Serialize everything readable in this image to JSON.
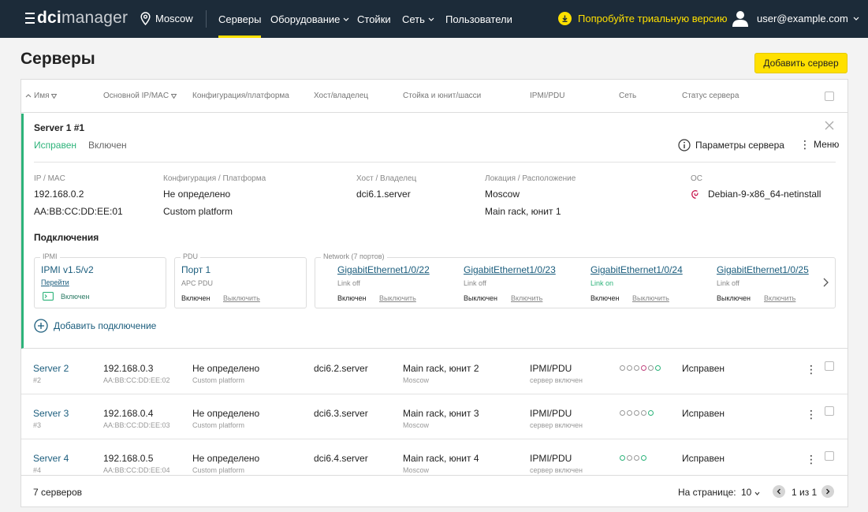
{
  "nav": {
    "logo_bold": "dci",
    "logo_light": "manager",
    "location": "Moscow",
    "items": [
      {
        "label": "Серверы",
        "active": true
      },
      {
        "label": "Оборудование",
        "caret": true
      },
      {
        "label": "Стойки"
      },
      {
        "label": "Сеть",
        "caret": true
      },
      {
        "label": "Пользователи"
      }
    ],
    "trial": "Попробуйте триальную версию",
    "user": "user@example.com"
  },
  "page": {
    "title": "Серверы",
    "add_button": "Добавить сервер"
  },
  "table": {
    "headers": {
      "name": "Имя",
      "ip": "Основной IP/MAC",
      "config": "Конфигурация/платформа",
      "host": "Хост/владелец",
      "rack": "Стойка и юнит/шасси",
      "ipmi": "IPMI/PDU",
      "net": "Сеть",
      "status": "Статус сервера"
    }
  },
  "expanded": {
    "title": "Server 1 #1",
    "status": "Исправен",
    "power": "Включен",
    "params": "Параметры сервера",
    "menu": "Меню",
    "fields": {
      "ipmac_label": "IP / MAC",
      "ip": "192.168.0.2",
      "mac": "AA:BB:CC:DD:EE:01",
      "config_label": "Конфигурация / Платформа",
      "config": "Не определено",
      "platform": "Custom platform",
      "host_label": "Хост / Владелец",
      "host": "dci6.1.server",
      "loc_label": "Локация / Расположение",
      "location": "Moscow",
      "rack": "Main rack, юнит 1",
      "os_label": "ОС",
      "os": "Debian-9-x86_64-netinstall"
    },
    "connections_title": "Подключения",
    "ipmi": {
      "legend": "IPMI",
      "name": "IPMI v1.5/v2",
      "goto": "Перейти",
      "state": "Включен"
    },
    "pdu": {
      "legend": "PDU",
      "port": "Порт 1",
      "model": "APC PDU",
      "state": "Включен",
      "action": "Выключить"
    },
    "network": {
      "legend": "Network (7 портов)",
      "ports": [
        {
          "name": "GigabitEthernet1/0/22",
          "link": "Link off",
          "state": "Включен",
          "action": "Выключить",
          "link_on": false
        },
        {
          "name": "GigabitEthernet1/0/23",
          "link": "Link off",
          "state": "Выключен",
          "action": "Включить",
          "link_on": false
        },
        {
          "name": "GigabitEthernet1/0/24",
          "link": "Link on",
          "state": "Включен",
          "action": "Выключить",
          "link_on": true
        },
        {
          "name": "GigabitEthernet1/0/25",
          "link": "Link off",
          "state": "Выключен",
          "action": "Включить",
          "link_on": false
        }
      ]
    },
    "add_connection": "Добавить подключение"
  },
  "rows": [
    {
      "name": "Server 2",
      "num": "#2",
      "ip": "192.168.0.3",
      "mac": "AA:BB:CC:DD:EE:02",
      "config": "Не определено",
      "platform": "Custom platform",
      "host": "dci6.2.server",
      "rack": "Main rack, юнит 2",
      "location": "Moscow",
      "ipmi": "IPMI/PDU",
      "ipmi_state": "сервер включен",
      "status": "Исправен",
      "dots": [
        "#999",
        "#999",
        "#999",
        "#c0457e",
        "#999",
        "#2db37a"
      ]
    },
    {
      "name": "Server 3",
      "num": "#3",
      "ip": "192.168.0.4",
      "mac": "AA:BB:CC:DD:EE:03",
      "config": "Не определено",
      "platform": "Custom platform",
      "host": "dci6.3.server",
      "rack": "Main rack, юнит 3",
      "location": "Moscow",
      "ipmi": "IPMI/PDU",
      "ipmi_state": "сервер включен",
      "status": "Исправен",
      "dots": [
        "#999",
        "#999",
        "#999",
        "#999",
        "#2db37a"
      ]
    },
    {
      "name": "Server 4",
      "num": "#4",
      "ip": "192.168.0.5",
      "mac": "AA:BB:CC:DD:EE:04",
      "config": "Не определено",
      "platform": "Custom platform",
      "host": "dci6.4.server",
      "rack": "Main rack, юнит 4",
      "location": "Moscow",
      "ipmi": "IPMI/PDU",
      "ipmi_state": "сервер включен",
      "status": "Исправен",
      "dots": [
        "#2db37a",
        "#999",
        "#999",
        "#2db37a"
      ]
    }
  ],
  "footer": {
    "count": "7 серверов",
    "per_page_label": "На странице:",
    "per_page": "10",
    "page_info": "1 из 1"
  },
  "colors": {
    "nav_bg": "#1c2b39",
    "accent": "#ffe000",
    "ok": "#2db37a",
    "link": "#1b5d7d"
  }
}
